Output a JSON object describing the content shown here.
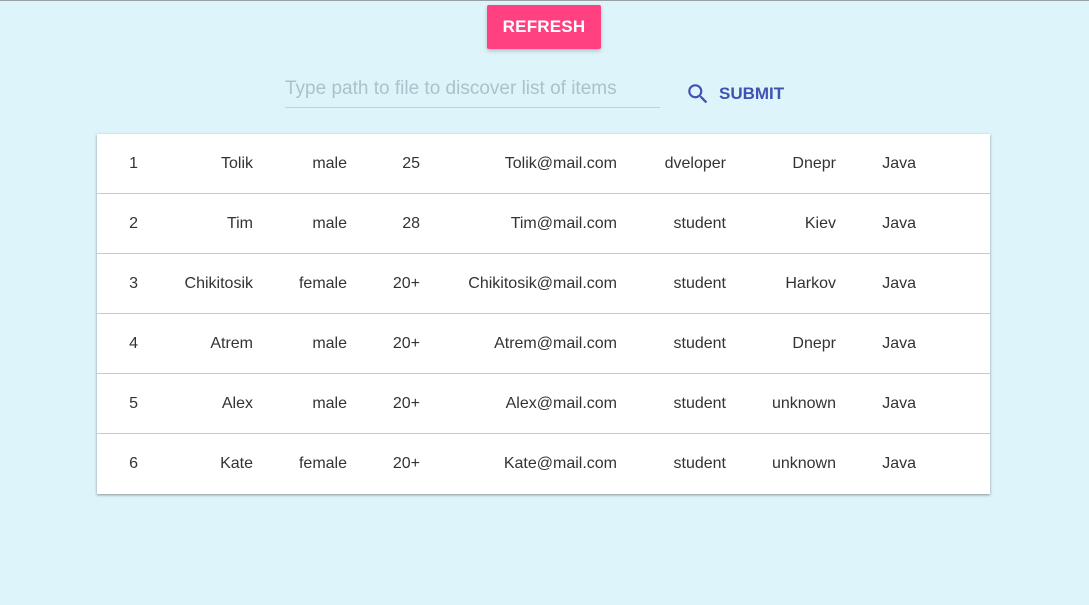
{
  "toolbar": {
    "refresh_label": "REFRESH"
  },
  "search": {
    "value": "",
    "placeholder": "Type path to file to discover list of items",
    "submit_label": "SUBMIT",
    "submit_icon": "search-icon"
  },
  "colors": {
    "background": "#ddf5fa",
    "refresh_button": "#ff4081",
    "submit_accent": "#3f51b5"
  },
  "table": {
    "rows": [
      {
        "id": "1",
        "name": "Tolik",
        "gender": "male",
        "age": "25",
        "email": "Tolik@mail.com",
        "job": "dveloper",
        "city": "Dnepr",
        "lang": "Java"
      },
      {
        "id": "2",
        "name": "Tim",
        "gender": "male",
        "age": "28",
        "email": "Tim@mail.com",
        "job": "student",
        "city": "Kiev",
        "lang": "Java"
      },
      {
        "id": "3",
        "name": "Chikitosik",
        "gender": "female",
        "age": "20+",
        "email": "Chikitosik@mail.com",
        "job": "student",
        "city": "Harkov",
        "lang": "Java"
      },
      {
        "id": "4",
        "name": "Atrem",
        "gender": "male",
        "age": "20+",
        "email": "Atrem@mail.com",
        "job": "student",
        "city": "Dnepr",
        "lang": "Java"
      },
      {
        "id": "5",
        "name": "Alex",
        "gender": "male",
        "age": "20+",
        "email": "Alex@mail.com",
        "job": "student",
        "city": "unknown",
        "lang": "Java"
      },
      {
        "id": "6",
        "name": "Kate",
        "gender": "female",
        "age": "20+",
        "email": "Kate@mail.com",
        "job": "student",
        "city": "unknown",
        "lang": "Java"
      }
    ]
  }
}
